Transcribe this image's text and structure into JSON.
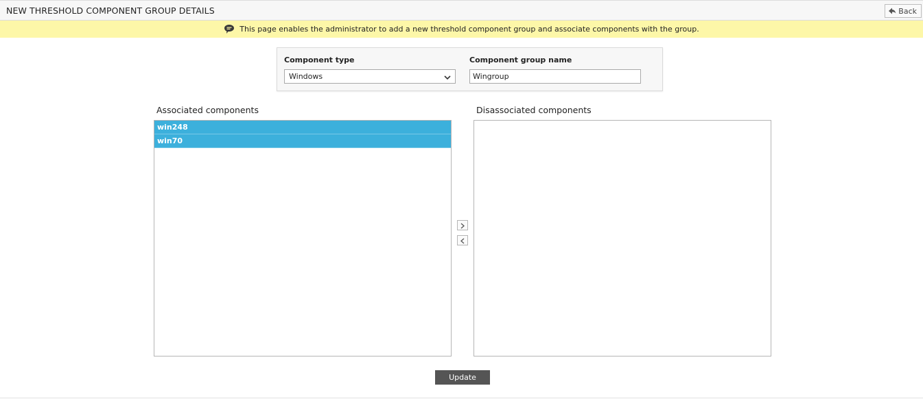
{
  "header": {
    "title": "NEW THRESHOLD COMPONENT GROUP DETAILS",
    "back_label": "Back"
  },
  "info": {
    "text": "This page enables the administrator to add a new threshold component group and associate components with the group."
  },
  "form": {
    "component_type_label": "Component type",
    "component_type_value": "Windows",
    "group_name_label": "Component group name",
    "group_name_value": "Wingroup"
  },
  "associated": {
    "label": "Associated components",
    "items": [
      "win248",
      "win70"
    ]
  },
  "disassociated": {
    "label": "Disassociated components",
    "items": []
  },
  "actions": {
    "update_label": "Update"
  },
  "colors": {
    "selected_item": "#3cb0dc",
    "info_bar": "#fdf7a8",
    "update_button": "#555555"
  }
}
